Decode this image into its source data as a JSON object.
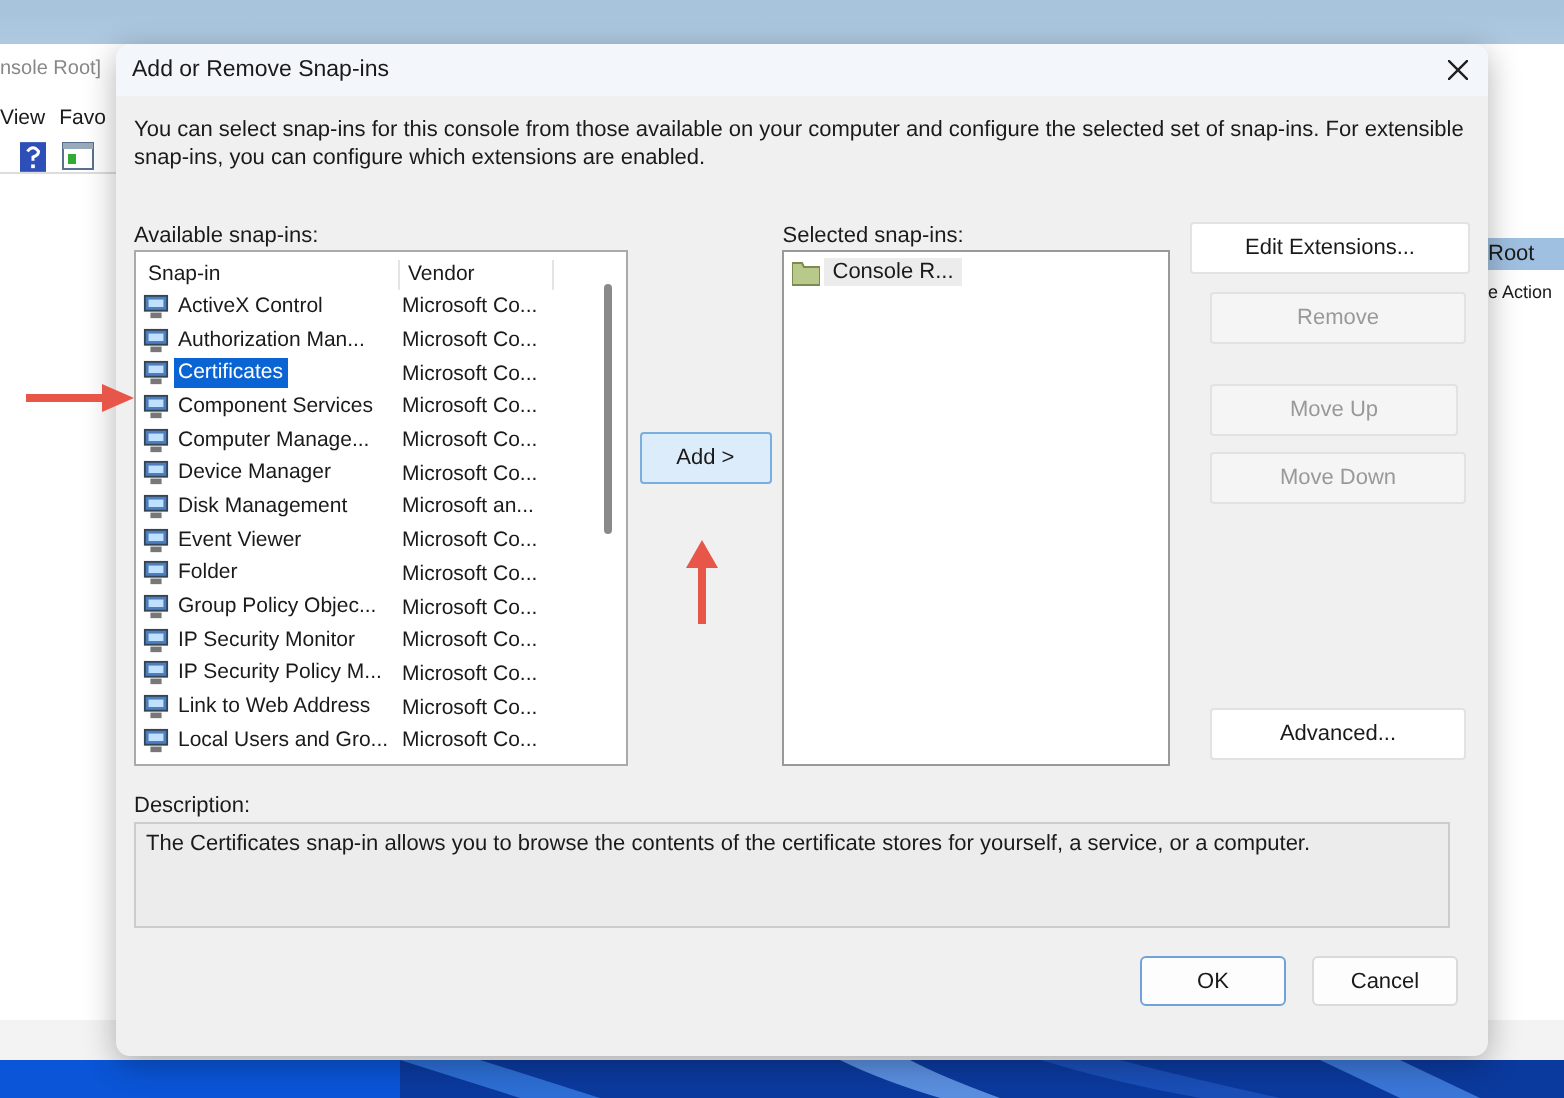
{
  "background_window": {
    "title": "nsole Root]",
    "menu": [
      "View",
      "Favo"
    ],
    "pane_header": "Root",
    "pane_item": "e Action"
  },
  "dialog": {
    "title": "Add or Remove Snap-ins",
    "intro": "You can select snap-ins for this console from those available on your computer and configure the selected set of snap-ins. For extensible snap-ins, you can configure which extensions are enabled.",
    "available_label": "Available snap-ins:",
    "available": {
      "columns": [
        "Snap-in",
        "Vendor"
      ],
      "rows": [
        {
          "snap_in": "ActiveX Control",
          "vendor": "Microsoft Co...",
          "selected": false
        },
        {
          "snap_in": "Authorization Man...",
          "vendor": "Microsoft Co...",
          "selected": false
        },
        {
          "snap_in": "Certificates",
          "vendor": "Microsoft Co...",
          "selected": true
        },
        {
          "snap_in": "Component Services",
          "vendor": "Microsoft Co...",
          "selected": false
        },
        {
          "snap_in": "Computer Manage...",
          "vendor": "Microsoft Co...",
          "selected": false
        },
        {
          "snap_in": "Device Manager",
          "vendor": "Microsoft Co...",
          "selected": false
        },
        {
          "snap_in": "Disk Management",
          "vendor": "Microsoft an...",
          "selected": false
        },
        {
          "snap_in": "Event Viewer",
          "vendor": "Microsoft Co...",
          "selected": false
        },
        {
          "snap_in": "Folder",
          "vendor": "Microsoft Co...",
          "selected": false
        },
        {
          "snap_in": "Group Policy Objec...",
          "vendor": "Microsoft Co...",
          "selected": false
        },
        {
          "snap_in": "IP Security Monitor",
          "vendor": "Microsoft Co...",
          "selected": false
        },
        {
          "snap_in": "IP Security Policy M...",
          "vendor": "Microsoft Co...",
          "selected": false
        },
        {
          "snap_in": "Link to Web Address",
          "vendor": "Microsoft Co...",
          "selected": false
        },
        {
          "snap_in": "Local Users and Gro...",
          "vendor": "Microsoft Co...",
          "selected": false
        }
      ]
    },
    "add_button": "Add >",
    "selected_label": "Selected snap-ins:",
    "selected_items": [
      "Console R..."
    ],
    "side_buttons": [
      {
        "label": "Edit Extensions...",
        "disabled": false
      },
      {
        "label": "Remove",
        "disabled": true
      },
      {
        "label": "Move Up",
        "disabled": true
      },
      {
        "label": "Move Down",
        "disabled": true
      },
      {
        "label": "Advanced...",
        "disabled": false
      }
    ],
    "description_label": "Description:",
    "description": "The Certificates snap-in allows you to browse the contents of the certificate stores for yourself, a service, or a computer.",
    "buttons": [
      {
        "label": "OK",
        "default": true
      },
      {
        "label": "Cancel",
        "default": false
      }
    ]
  }
}
